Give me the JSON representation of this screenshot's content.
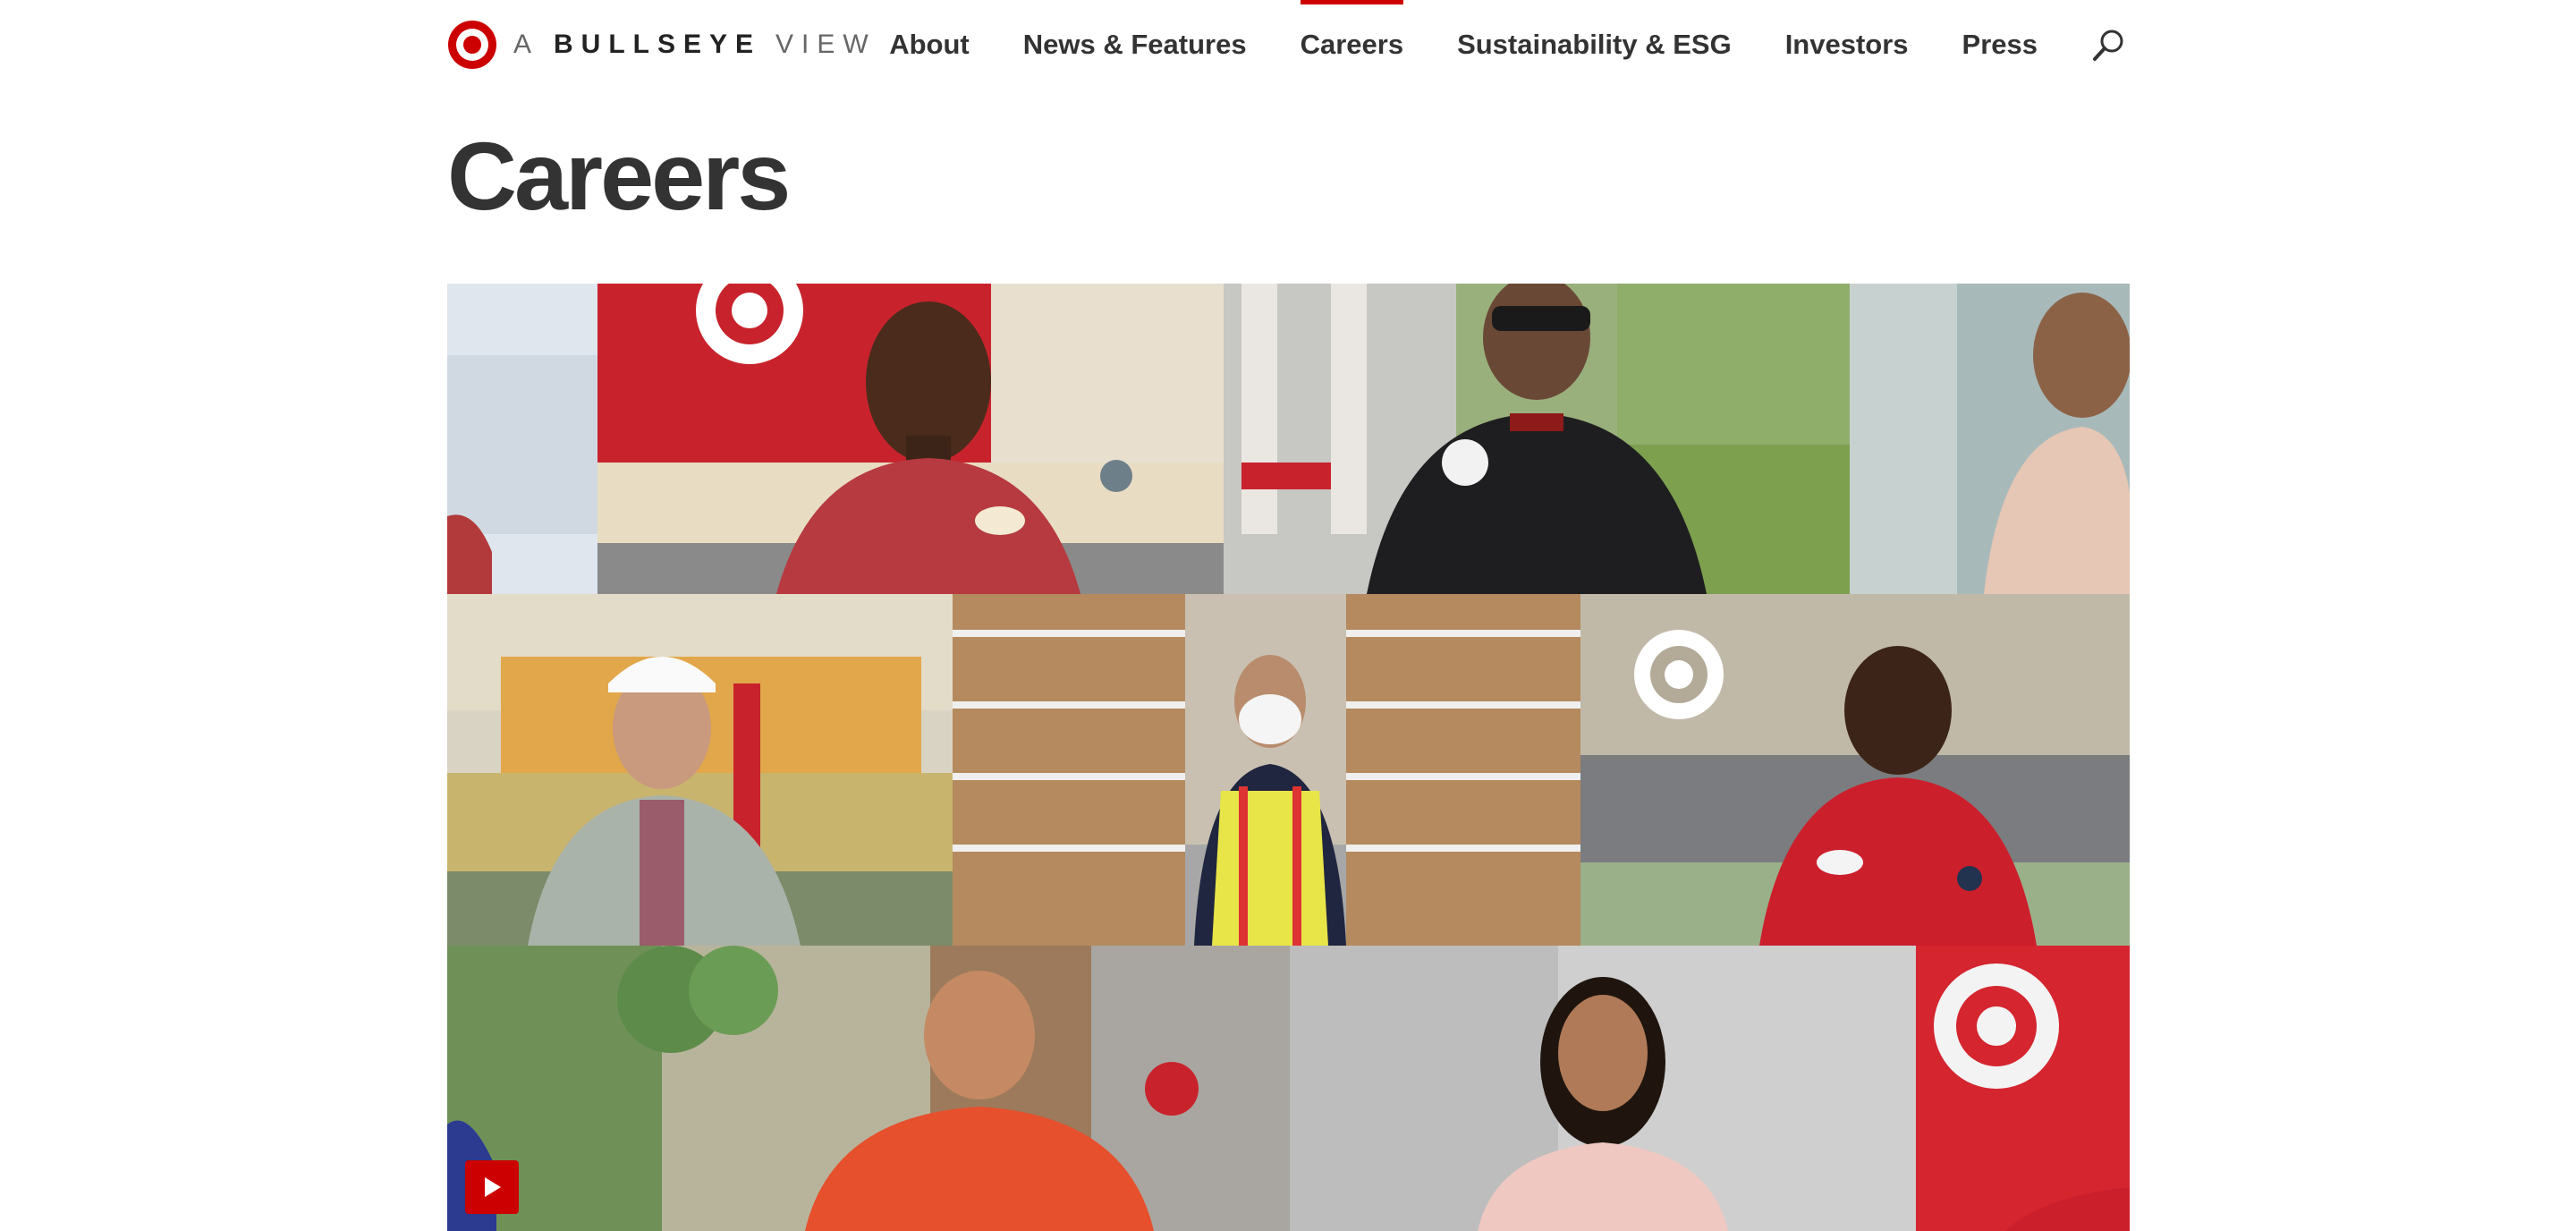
{
  "header": {
    "logo": {
      "prefix": "A",
      "brand": "BULLSEYE",
      "suffix": "VIEW",
      "icon": "target-bullseye-icon"
    },
    "nav": [
      {
        "label": "About",
        "active": false
      },
      {
        "label": "News & Features",
        "active": false
      },
      {
        "label": "Careers",
        "active": true
      },
      {
        "label": "Sustainability & ESG",
        "active": false
      },
      {
        "label": "Investors",
        "active": false
      },
      {
        "label": "Press",
        "active": false
      }
    ],
    "search_icon": "search-icon"
  },
  "page": {
    "title": "Careers"
  },
  "video": {
    "play_icon": "play-icon",
    "colors": {
      "brand_red": "#cc0000",
      "target_red": "#c8102e"
    }
  }
}
